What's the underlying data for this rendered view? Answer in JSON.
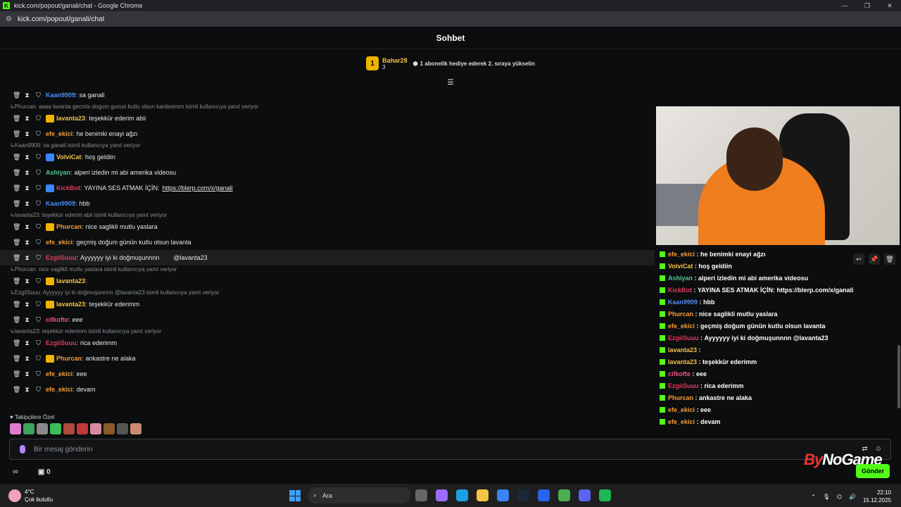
{
  "browser": {
    "window_title": "kick.com/popout/ganali/chat - Google Chrome",
    "url": "kick.com/popout/ganali/chat"
  },
  "chat_header": {
    "title": "Sohbet"
  },
  "pinned": {
    "rank": "1",
    "user": "Bahar28",
    "count": "3",
    "gift_text": "1 abonelik hediye ederek 2. sıraya yükselin"
  },
  "messages": [
    {
      "type": "msg",
      "user": "Kaan9909",
      "user_color": "#4e8bf5",
      "text": "sa ganali"
    },
    {
      "type": "reply",
      "text": "Phurcan: aaaa lavanta gecmis dogum gunun kutlu olsun kardesimm isimli kullanıcıya yanıt veriyor"
    },
    {
      "type": "msg",
      "user": "lavanta23",
      "user_color": "#f3c14a",
      "badge": "#f0b400",
      "text": "teşekkür ederim abii"
    },
    {
      "type": "msg",
      "user": "efe_ekici",
      "user_color": "#f59b3b",
      "text": "he benimki enayi ağzı"
    },
    {
      "type": "reply",
      "text": "Kaan9909: sa ganali isimli kullanıcıya yanıt veriyor"
    },
    {
      "type": "msg",
      "user": "VolviCat",
      "user_color": "#f3c14a",
      "badge": "#3a86ff",
      "text": "hoş geldiin"
    },
    {
      "type": "msg",
      "user": "Ashiyan",
      "user_color": "#53c48f",
      "text": "alperi izledin mi abi amerika videosu"
    },
    {
      "type": "msg",
      "user": "KickBot",
      "user_color": "#e23a5a",
      "badge": "#3a86ff",
      "text": "YAYINA SES ATMAK İÇİN:",
      "link": "https://blerp.com/x/ganali"
    },
    {
      "type": "msg",
      "user": "Kaan9909",
      "user_color": "#4e8bf5",
      "text": "hbb"
    },
    {
      "type": "reply",
      "text": "lavanta23: teşekkür ederim abii    isimli kullanıcıya yanıt veriyor"
    },
    {
      "type": "msg",
      "user": "Phurcan",
      "user_color": "#f59b3b",
      "badge": "#f0b400",
      "text": "nice saglikli mutlu yaslara"
    },
    {
      "type": "msg",
      "user": "efe_ekici",
      "user_color": "#f59b3b",
      "text": "geçmiş doğum günün kutlu olsun lavanta"
    },
    {
      "type": "msg",
      "user": "EzgiiSuuu",
      "user_color": "#e23a5a",
      "text": "Ayyyyyy iyi ki doğmuşunnnn",
      "mention": "@lavanta23",
      "highlight": true
    },
    {
      "type": "reply",
      "text": "Phurcan: nice saglikli mutlu yaslara isimli kullanıcıya yanıt veriyor"
    },
    {
      "type": "msg",
      "user": "lavanta23",
      "user_color": "#f3c14a",
      "badge": "#f0b400",
      "text": ""
    },
    {
      "type": "reply",
      "text": "EzgiiSuuu: Ayyyyyy iyi ki doğmuşunnnn    @lavanta23 isimli kullanıcıya yanıt veriyor"
    },
    {
      "type": "msg",
      "user": "lavanta23",
      "user_color": "#f3c14a",
      "badge": "#f0b400",
      "text": "teşekkür ederimm"
    },
    {
      "type": "msg",
      "user": "cifkofte",
      "user_color": "#e75480",
      "text": "eee"
    },
    {
      "type": "reply",
      "text": "lavanta23: teşekkür ederimm    isimli kullanıcıya yanıt veriyor"
    },
    {
      "type": "msg",
      "user": "EzgiiSuuu",
      "user_color": "#e23a5a",
      "text": "rica ederimm"
    },
    {
      "type": "msg",
      "user": "Phurcan",
      "user_color": "#f59b3b",
      "badge": "#f0b400",
      "text": "ankastre ne alaka"
    },
    {
      "type": "msg",
      "user": "efe_ekici",
      "user_color": "#f59b3b",
      "text": "eee"
    },
    {
      "type": "msg",
      "user": "efe_ekici",
      "user_color": "#f59b3b",
      "text": "devam"
    }
  ],
  "followers_label": "Takipçilere Özel",
  "input": {
    "placeholder": "Bir mesaj gönderin",
    "send_label": "Gönder"
  },
  "bottom": {
    "gift_count": "0"
  },
  "overlay": [
    {
      "user": "efe_ekici",
      "user_color": "#f59b3b",
      "text": "he benimki enayi ağzı"
    },
    {
      "user": "VolviCat",
      "user_color": "#f3c14a",
      "text": "hoş geldiin"
    },
    {
      "user": "Ashiyan",
      "user_color": "#53c48f",
      "text": "alperi izledin mi abi amerika videosu"
    },
    {
      "user": "KickBot",
      "user_color": "#e23a5a",
      "text": "YAYINA SES ATMAK İÇİN: https://blerp.com/x/ganali"
    },
    {
      "user": "Kaan9909",
      "user_color": "#4e8bf5",
      "text": "hbb"
    },
    {
      "user": "Phurcan",
      "user_color": "#f59b3b",
      "text": "nice saglikli mutlu yaslara"
    },
    {
      "user": "efe_ekici",
      "user_color": "#f59b3b",
      "text": "geçmiş doğum günün kutlu olsun lavanta"
    },
    {
      "user": "EzgiiSuuu",
      "user_color": "#e23a5a",
      "text": "Ayyyyyy iyi ki doğmuşunnnn    @lavanta23"
    },
    {
      "user": "lavanta23",
      "user_color": "#f3c14a",
      "text": ""
    },
    {
      "user": "lavanta23",
      "user_color": "#f3c14a",
      "text": "teşekkür ederimm"
    },
    {
      "user": "cifkofte",
      "user_color": "#e75480",
      "text": "eee"
    },
    {
      "user": "EzgiiSuuu",
      "user_color": "#e23a5a",
      "text": "rica ederimm"
    },
    {
      "user": "Phurcan",
      "user_color": "#f59b3b",
      "text": "ankastre ne alaka"
    },
    {
      "user": "efe_ekici",
      "user_color": "#f59b3b",
      "text": "eee"
    },
    {
      "user": "efe_ekici",
      "user_color": "#f59b3b",
      "text": "devam"
    }
  ],
  "watermark": {
    "left": "By",
    "right": "NoGame"
  },
  "taskbar": {
    "temp": "4°C",
    "weather": "Çok bulutlu",
    "search": "Ara",
    "time": "22:10",
    "date": "15.12.2025"
  },
  "colors": {
    "accent": "#53fc18",
    "background": "#0b0d0e"
  }
}
